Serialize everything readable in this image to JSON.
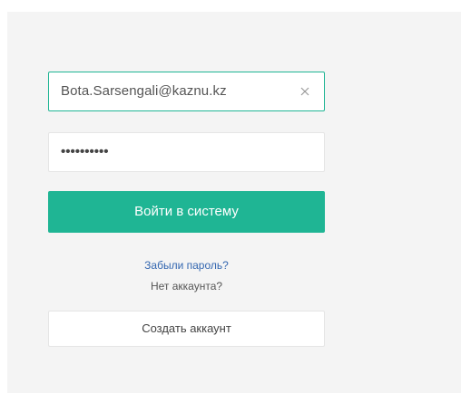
{
  "login": {
    "email_value": "Bota.Sarsengali@kaznu.kz",
    "password_masked": "••••••••••",
    "submit_label": "Войти в систему",
    "forgot_password": "Забыли пароль?",
    "no_account_text": "Нет аккаунта?",
    "create_account_label": "Создать аккаунт"
  },
  "icons": {
    "clear": "close-icon"
  },
  "colors": {
    "accent": "#1fb594",
    "link": "#3467b0",
    "panel_bg": "#f4f4f4",
    "input_border": "#e5e5e5"
  }
}
